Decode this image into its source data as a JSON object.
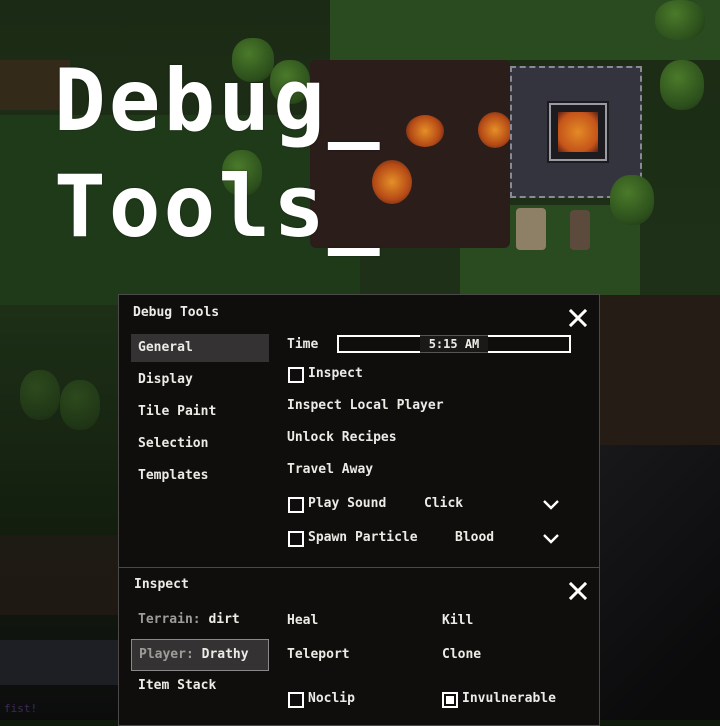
{
  "title": {
    "line1": "Debug_",
    "line2": "Tools_"
  },
  "background": {
    "corner_text": "fist!"
  },
  "debug_panel": {
    "title": "Debug Tools",
    "close_icon": "close-x-icon",
    "nav": [
      {
        "label": "General",
        "active": true
      },
      {
        "label": "Display",
        "active": false
      },
      {
        "label": "Tile Paint",
        "active": false
      },
      {
        "label": "Selection",
        "active": false
      },
      {
        "label": "Templates",
        "active": false
      }
    ],
    "general": {
      "time_label": "Time",
      "time_value": "5:15 AM",
      "inspect_checkbox": {
        "label": "Inspect",
        "checked": false
      },
      "inspect_local_player": "Inspect Local Player",
      "unlock_recipes": "Unlock Recipes",
      "travel_away": "Travel Away",
      "play_sound": {
        "label": "Play Sound",
        "checked": false,
        "selected": "Click",
        "dropdown_icon": "chevron-down-icon"
      },
      "spawn_particle": {
        "label": "Spawn Particle",
        "checked": false,
        "selected": "Blood",
        "dropdown_icon": "chevron-down-icon"
      }
    }
  },
  "inspect_panel": {
    "title": "Inspect",
    "close_icon": "close-x-icon",
    "targets": [
      {
        "key": "Terrain:",
        "value": "dirt",
        "active": false
      },
      {
        "key": "Player:",
        "value": "Drathy",
        "active": true
      },
      {
        "key": "Item Stack",
        "value": "",
        "active": false
      }
    ],
    "actions": {
      "heal": "Heal",
      "kill": "Kill",
      "teleport": "Teleport",
      "clone": "Clone"
    },
    "noclip": {
      "label": "Noclip",
      "checked": false
    },
    "invulnerable": {
      "label": "Invulnerable",
      "checked": true
    }
  }
}
